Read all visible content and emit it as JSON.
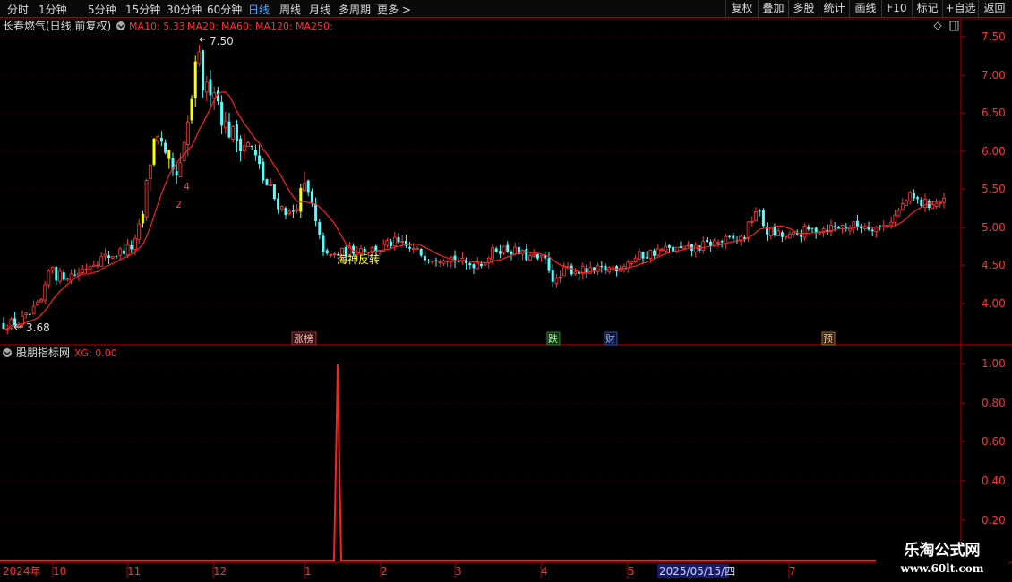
{
  "toolbar": {
    "periods": [
      "分时",
      "1分钟",
      "5分钟",
      "15分钟",
      "30分钟",
      "60分钟",
      "日线",
      "周线",
      "月线",
      "多周期",
      "更多"
    ],
    "active_period": "日线",
    "more_arrow": ">",
    "tools": [
      "复权",
      "叠加",
      "多股",
      "统计",
      "画线",
      "F10",
      "标记",
      "+自选",
      "返回"
    ]
  },
  "header": {
    "stock_title": "长春燃气(日线,前复权)",
    "ma_items": [
      "MA10: 5.33",
      "MA20:",
      "MA60:",
      "MA120:",
      "MA250:"
    ]
  },
  "chart": {
    "price_ticks": [
      "7.50",
      "7.00",
      "6.50",
      "6.00",
      "5.50",
      "5.00",
      "4.50",
      "4.00"
    ],
    "high_label": "7.50",
    "low_label": "3.68",
    "annotations": [
      "2",
      "4",
      "海神反转"
    ],
    "event_tags": [
      "涨榜",
      "跌",
      "财",
      "预"
    ],
    "indicator_title": "股朋指标网",
    "indicator_value": "XG: 0.00",
    "indicator_ticks": [
      "1.00",
      "0.80",
      "0.60",
      "0.40",
      "0.20"
    ],
    "date_labels": [
      "2024年",
      "10",
      "11",
      "12",
      "1",
      "2",
      "3",
      "4",
      "5",
      "7"
    ],
    "date_highlight": "2025/05/15/四",
    "colors": {
      "up": "#ff3b3b",
      "down": "#54ffff",
      "signal": "#ffff00",
      "ma": "#ff2020",
      "axis": "#b00000",
      "active": "#58a6ff"
    }
  },
  "watermark": {
    "line1": "乐淘公式网",
    "line2": "www.60lt.com"
  }
}
